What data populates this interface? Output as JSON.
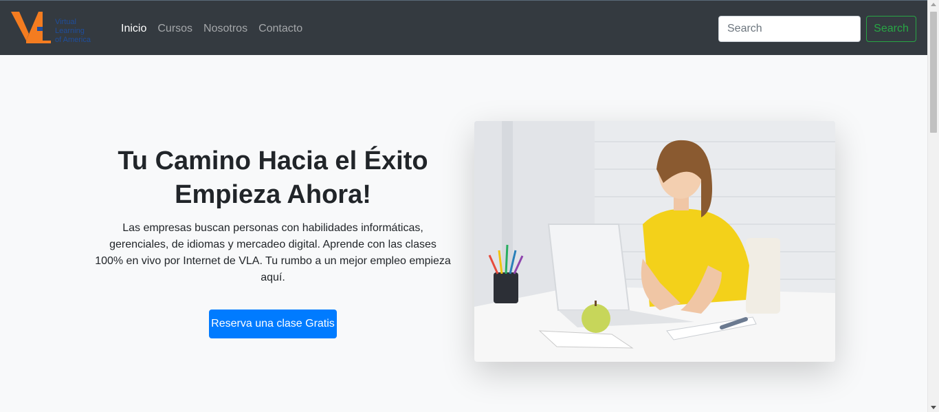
{
  "nav": {
    "brand_text": "Virtual Learning of America",
    "links": [
      {
        "label": "Inicio",
        "active": true
      },
      {
        "label": "Cursos",
        "active": false
      },
      {
        "label": "Nosotros",
        "active": false
      },
      {
        "label": "Contacto",
        "active": false
      }
    ],
    "search": {
      "placeholder": "Search",
      "button_label": "Search"
    }
  },
  "hero": {
    "title_line1": "Tu Camino Hacia el Éxito",
    "title_line2": "Empieza Ahora!",
    "description": "Las empresas buscan personas con habilidades informáticas, gerenciales, de idiomas y mercadeo digital. Aprende con las clases 100% en vivo por Internet de VLA. Tu rumbo a un mejor empleo empieza aquí.",
    "cta_label": "Reserva una clase Gratis"
  },
  "colors": {
    "navbar": "#343a40",
    "primary": "#007bff",
    "success": "#28a745",
    "brand_orange": "#f47c20",
    "brand_blue": "#1f4e9c"
  }
}
